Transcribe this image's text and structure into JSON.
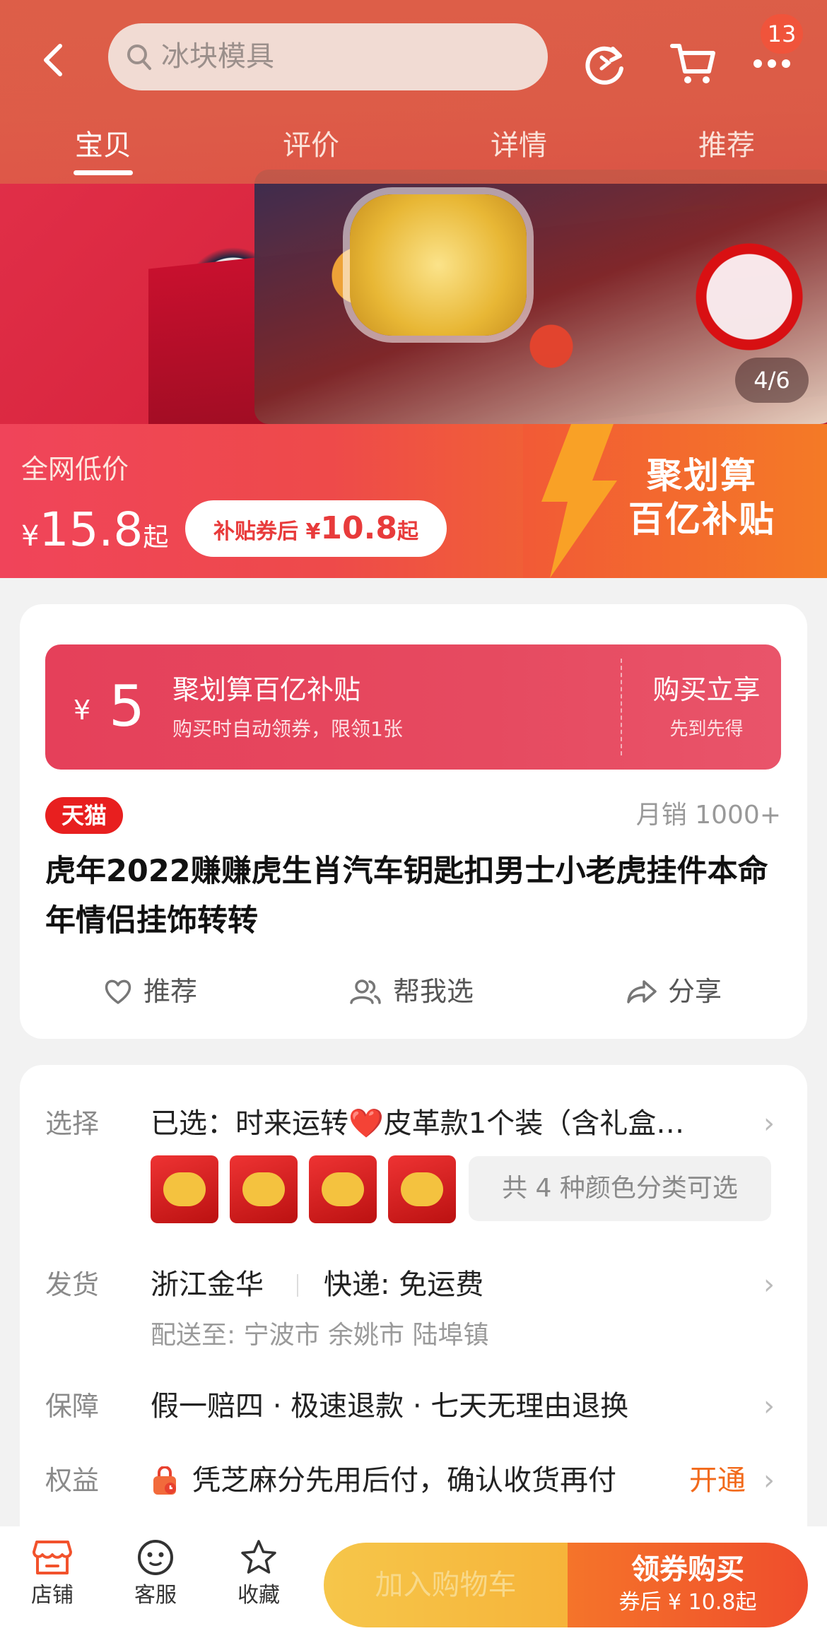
{
  "header": {
    "search_placeholder": "冰块模具",
    "badge_count": "13",
    "tabs": [
      {
        "label": "宝贝",
        "active": true
      },
      {
        "label": "评价",
        "active": false
      },
      {
        "label": "详情",
        "active": false
      },
      {
        "label": "推荐",
        "active": false
      }
    ]
  },
  "gallery": {
    "counter": "4/6"
  },
  "promo": {
    "low_label": "全网低价",
    "currency": "¥",
    "price": "15.8",
    "price_suffix": "起",
    "pill_prefix": "补贴券后",
    "pill_currency": "¥",
    "pill_price": "10.8",
    "pill_suffix": "起",
    "brand_line1": "聚划算",
    "brand_line2": "百亿补贴"
  },
  "coupon": {
    "currency": "¥",
    "amount": "5",
    "title": "聚划算百亿补贴",
    "desc": "购买时自动领券，限领1张",
    "action": "购买立享",
    "action_sub": "先到先得"
  },
  "product": {
    "store_badge": "天猫",
    "monthly_sales": "月销 1000+",
    "title": "虎年2022赚赚虎生肖汽车钥匙扣男士小老虎挂件本命年情侣挂饰转转",
    "actions": {
      "recommend": "推荐",
      "help_choose": "帮我选",
      "share": "分享"
    }
  },
  "details": {
    "select": {
      "label": "选择",
      "value": "已选：时来运转❤️皮革款1个装（含礼盒…",
      "colors_summary": "共 4 种颜色分类可选"
    },
    "shipping": {
      "label": "发货",
      "origin": "浙江金华",
      "express": "快递: 免运费",
      "deliver_to": "配送至: 宁波市 余姚市 陆埠镇"
    },
    "guarantee": {
      "label": "保障",
      "value": "假一赔四 · 极速退款 · 七天无理由退换"
    },
    "benefits": {
      "label": "权益",
      "value": "凭芝麻分先用后付，确认收货再付",
      "action": "开通"
    }
  },
  "bottom_bar": {
    "store": "店铺",
    "service": "客服",
    "favorite": "收藏",
    "add_to_cart": "加入购物车",
    "buy_label": "领券购买",
    "buy_sub": "券后 ¥ 10.8起"
  },
  "colors": {
    "accent": "#e83b3b",
    "orange": "#f47a26",
    "tmall_red": "#e81f1f",
    "open_orange": "#f26a1b"
  }
}
